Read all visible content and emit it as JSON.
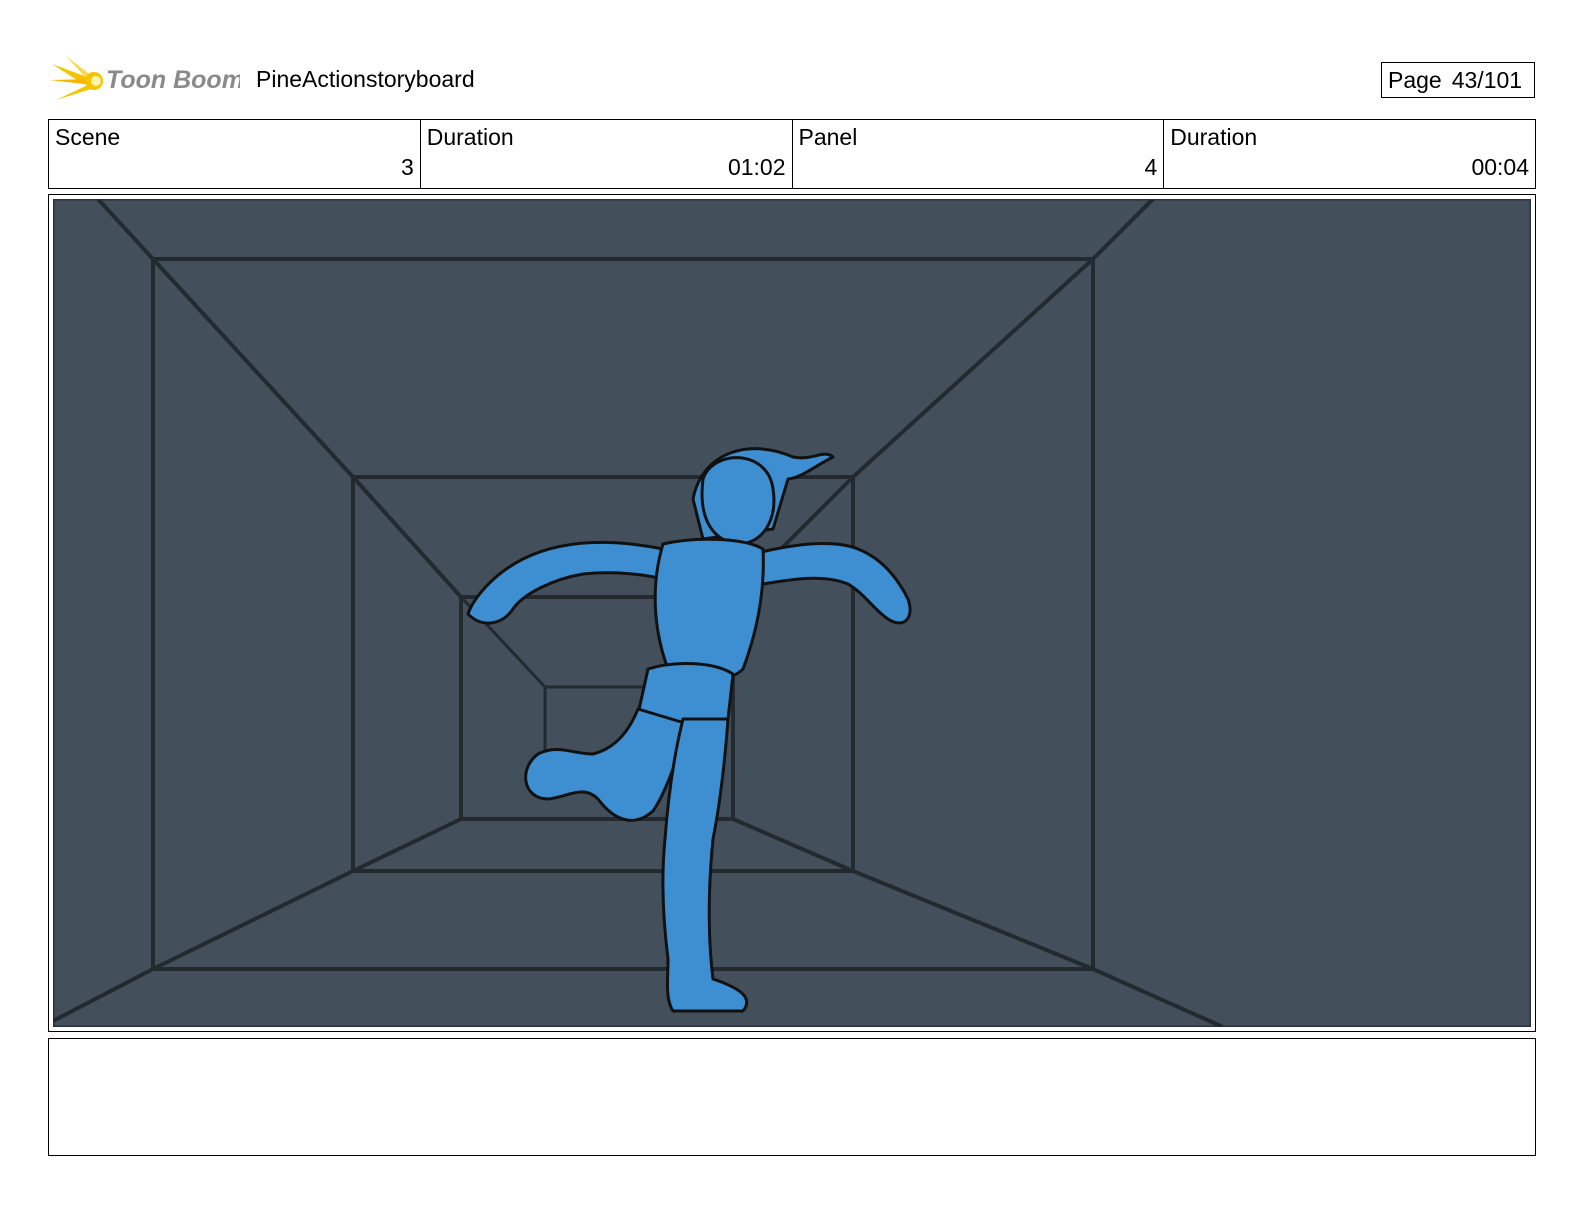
{
  "header": {
    "logo_text": "Toon Boom",
    "project_title": "PineActionstoryboard",
    "page_label": "Page",
    "page_number": "43/101"
  },
  "info": {
    "scene_label": "Scene",
    "scene_value": "3",
    "scene_duration_label": "Duration",
    "scene_duration_value": "01:02",
    "panel_label": "Panel",
    "panel_value": "4",
    "panel_duration_label": "Duration",
    "panel_duration_value": "00:04"
  },
  "notes": {
    "text": ""
  },
  "colors": {
    "background_wall": "#434f5a",
    "line": "#222a30",
    "character_fill": "#3d8fd1",
    "logo_flare": "#f5c400",
    "logo_text": "#8a8a8a"
  },
  "icons": {
    "logo": "toon-boom-starburst-icon"
  }
}
